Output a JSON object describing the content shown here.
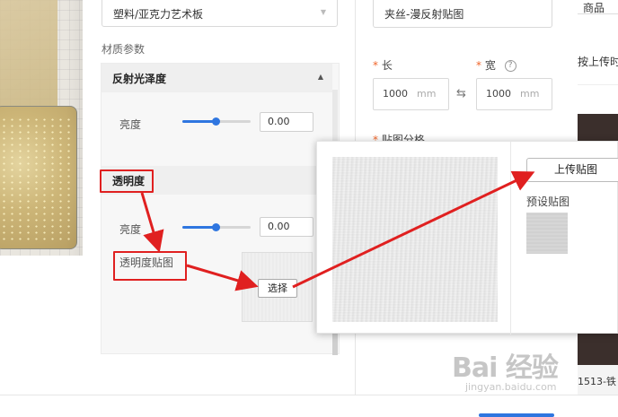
{
  "material": {
    "select_value": "塑料/亚克力艺术板",
    "params_label": "材质参数"
  },
  "sections": {
    "reflect": {
      "title": "反射光泽度",
      "brightness_label": "亮度",
      "brightness_value": "0.00",
      "slider_level": 0.5
    },
    "transparency": {
      "title": "透明度",
      "brightness_label": "亮度",
      "brightness_value": "0.00",
      "slider_level": 0.5,
      "map_label": "透明度贴图",
      "choose_label": "选择"
    }
  },
  "texture": {
    "name_value": "夹丝-漫反射贴图",
    "length_label": "长",
    "width_label": "宽",
    "required_mark": "*",
    "help_icon": "?",
    "length_value": "1000",
    "width_value": "1000",
    "unit": "mm",
    "swap_icon": "⇆",
    "partial_label": "贴图分格"
  },
  "popup": {
    "upload_label": "上传贴图",
    "preset_label": "预设贴图"
  },
  "right": {
    "top_text": "商品",
    "mid_text": "按上传时",
    "bottom_text": "1513-铁"
  },
  "watermark": {
    "main": "Bai 经验",
    "sub": "jingyan.baidu.com"
  },
  "colors": {
    "accent": "#2f76e0",
    "annotation": "#e02020",
    "required": "#f0662b"
  }
}
